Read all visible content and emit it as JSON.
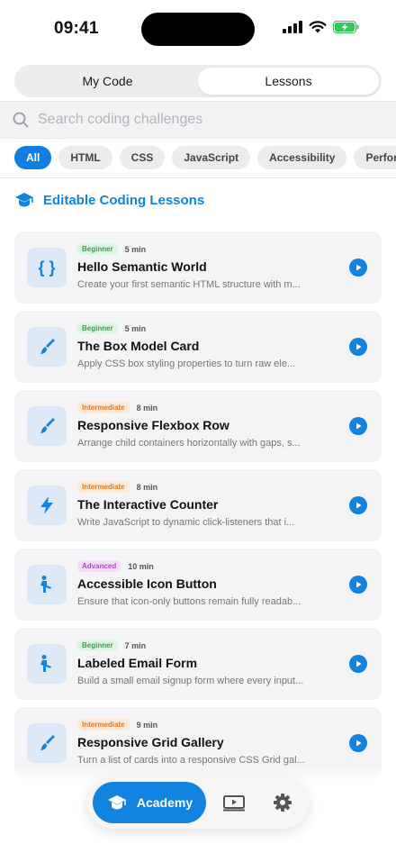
{
  "status": {
    "time": "09:41"
  },
  "segment": {
    "tabs": [
      "My Code",
      "Lessons"
    ],
    "active": "Lessons"
  },
  "search": {
    "placeholder": "Search coding challenges"
  },
  "filters": [
    "All",
    "HTML",
    "CSS",
    "JavaScript",
    "Accessibility",
    "Performa"
  ],
  "section": {
    "title": "Editable Coding Lessons",
    "icon": "graduation-cap-icon"
  },
  "lessons": [
    {
      "level": "Beginner",
      "duration": "5 min",
      "title": "Hello Semantic World",
      "description": "Create your first semantic HTML structure with m...",
      "icon": "braces-icon"
    },
    {
      "level": "Beginner",
      "duration": "5 min",
      "title": "The Box Model Card",
      "description": "Apply CSS box styling properties to turn raw ele...",
      "icon": "paintbrush-icon"
    },
    {
      "level": "Intermediate",
      "duration": "8 min",
      "title": "Responsive Flexbox Row",
      "description": "Arrange child containers horizontally with gaps, s...",
      "icon": "paintbrush-icon"
    },
    {
      "level": "Intermediate",
      "duration": "8 min",
      "title": "The Interactive Counter",
      "description": "Write JavaScript to dynamic click-listeners that i...",
      "icon": "bolt-icon"
    },
    {
      "level": "Advanced",
      "duration": "10 min",
      "title": "Accessible Icon Button",
      "description": "Ensure that icon-only buttons remain fully readab...",
      "icon": "accessibility-person-icon"
    },
    {
      "level": "Beginner",
      "duration": "7 min",
      "title": "Labeled Email Form",
      "description": "Build a small email signup form where every input...",
      "icon": "accessibility-person-icon"
    },
    {
      "level": "Intermediate",
      "duration": "9 min",
      "title": "Responsive Grid Gallery",
      "description": "Turn a list of cards into a responsive CSS Grid gal...",
      "icon": "paintbrush-icon"
    }
  ],
  "tabbar": {
    "academy_label": "Academy",
    "items": [
      "academy",
      "video",
      "settings"
    ]
  },
  "colors": {
    "accent": "#1383e0",
    "beginner": "#3b9b52",
    "intermediate": "#dc7a2a",
    "advanced": "#b34dc2"
  }
}
